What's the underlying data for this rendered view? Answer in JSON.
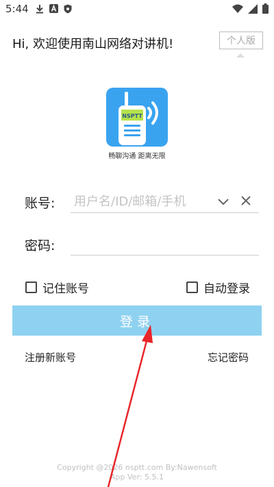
{
  "status_bar": {
    "time": "5:44",
    "left_icons": [
      "download-icon",
      "app-a-icon",
      "shield-icon"
    ],
    "right_icons": [
      "wifi-icon",
      "signal-icon",
      "battery-icon"
    ]
  },
  "header": {
    "greeting": "Hi, 欢迎使用南山网络对讲机!",
    "personal_button_label": "个人版"
  },
  "logo": {
    "badge_text": "NSPTT",
    "slogan": "畅聊沟通 距离无限",
    "brand_color": "#3aa3f0"
  },
  "form": {
    "account_label": "账号:",
    "account_placeholder": "用户名/ID/邮箱/手机",
    "account_value": "",
    "password_label": "密码:",
    "password_value": ""
  },
  "options": {
    "remember_label": "记住账号",
    "remember_checked": false,
    "autologin_label": "自动登录",
    "autologin_checked": false
  },
  "login_button": {
    "label": "登录",
    "color": "#8fd1f0"
  },
  "links": {
    "register": "注册新账号",
    "forgot_password": "忘记密码"
  },
  "footer": {
    "copyright": "Copyright @2026 nsptt.com By:Nawensoft",
    "version": "App Ver: 5.5.1"
  },
  "annotation": {
    "arrow_color": "#e8252a"
  }
}
